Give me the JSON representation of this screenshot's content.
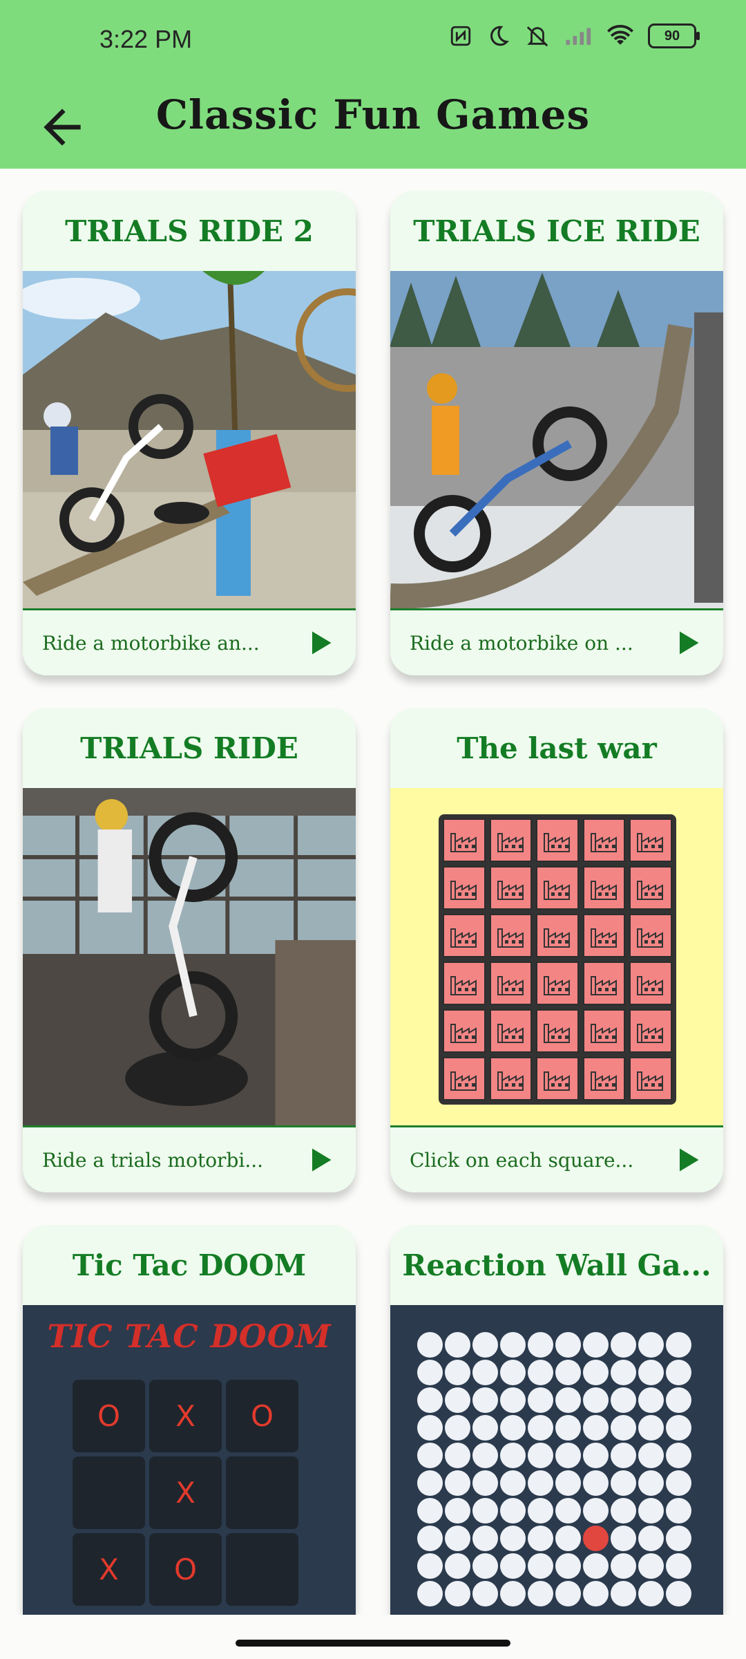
{
  "status_bar": {
    "time": "3:22 PM",
    "battery": "90",
    "icons": [
      "nfc-icon",
      "moon-icon",
      "mute-vibrate-icon",
      "signal-icon",
      "wifi-icon",
      "battery-icon"
    ]
  },
  "app_bar": {
    "title": "Classic Fun Games",
    "back_icon": "arrow-back-icon",
    "background": "#7fdc7d"
  },
  "games": [
    {
      "title": "TRIALS RIDE 2",
      "description": "Ride a motorbike an...",
      "play_icon": "play-icon"
    },
    {
      "title": "TRIALS ICE RIDE",
      "description": "Ride a motorbike on ...",
      "play_icon": "play-icon"
    },
    {
      "title": "TRIALS RIDE",
      "description": "Ride a trials motorbi...",
      "play_icon": "play-icon"
    },
    {
      "title": "The last war",
      "description": "Click on each square...",
      "play_icon": "play-icon"
    },
    {
      "title": "Tic Tac DOOM",
      "description": "",
      "thumb_title": "TIC TAC DOOM",
      "board": [
        "O",
        "X",
        "O",
        "",
        "X",
        "",
        "X",
        "O",
        ""
      ]
    },
    {
      "title": "Reaction Wall Ga...",
      "description": ""
    }
  ],
  "colors": {
    "card_title": "#147c24",
    "card_bg": "#eefbee",
    "accent": "#1d7f2b"
  }
}
